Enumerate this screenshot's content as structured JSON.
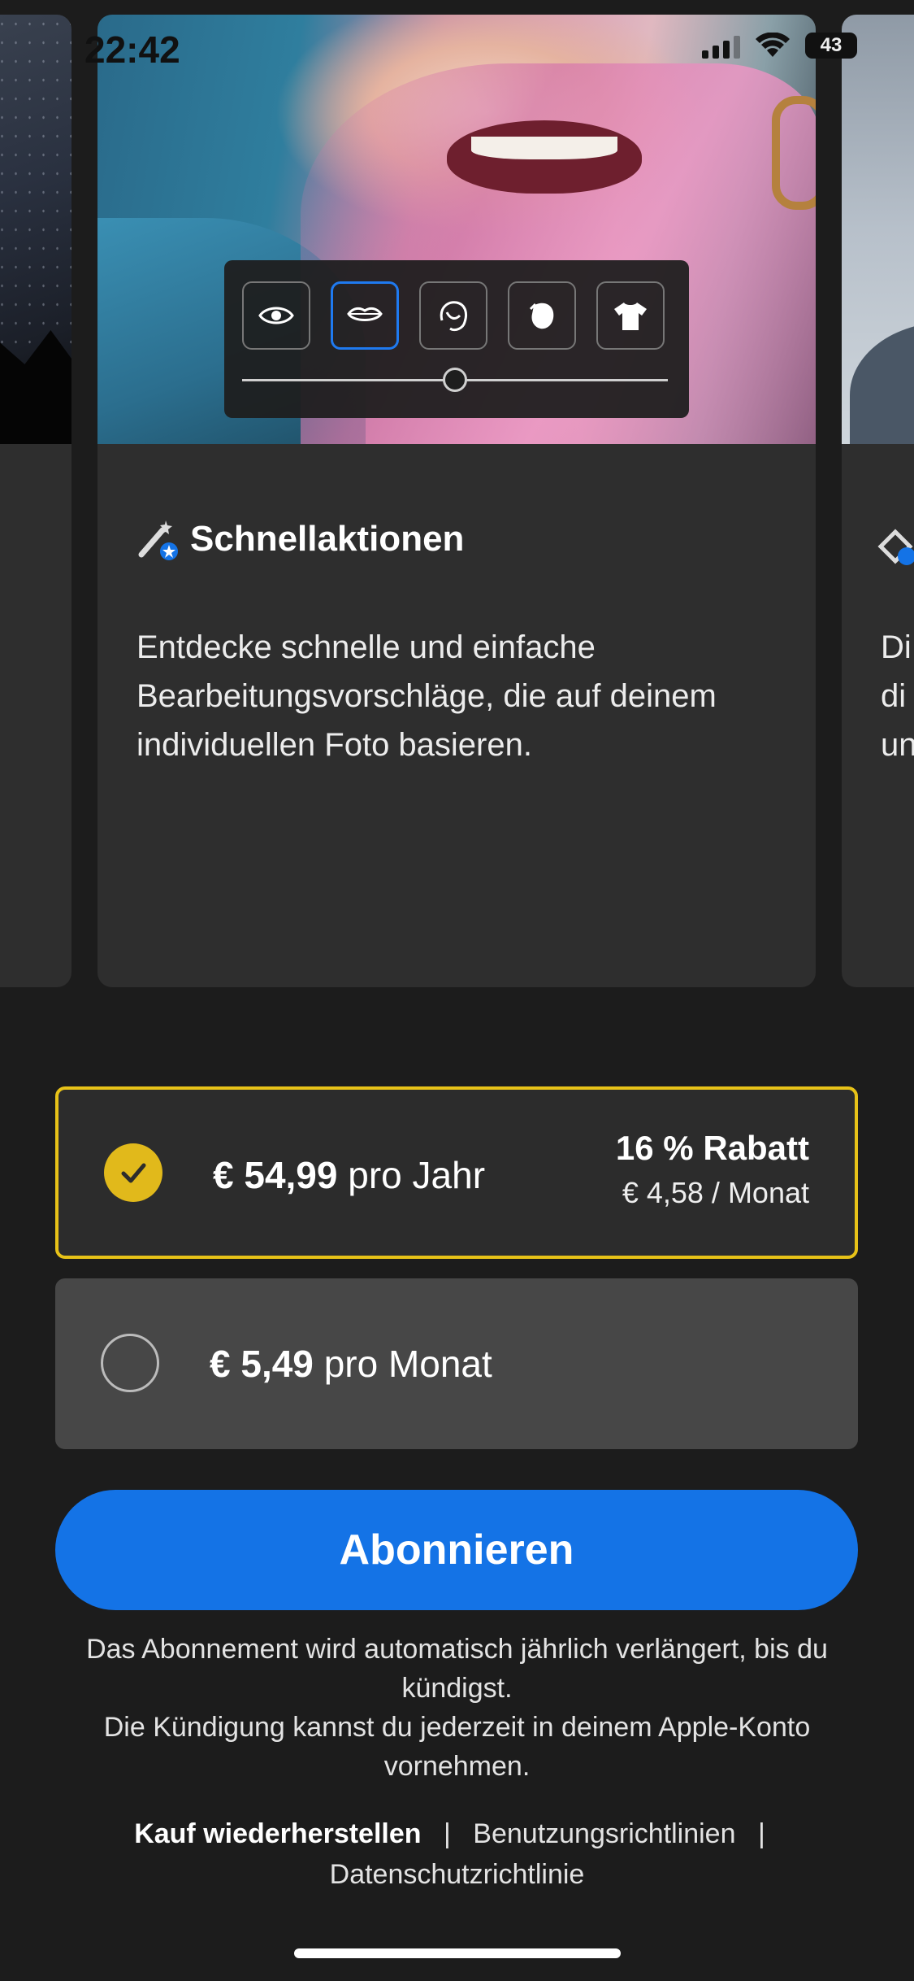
{
  "status_bar": {
    "time": "22:42",
    "battery": "43"
  },
  "features": {
    "main": {
      "title": "Schnellaktionen",
      "description": "Entdecke schnelle und einfache Bearbeitungsvorschläge, die auf deinem individuellen Foto basieren.",
      "tools": [
        "eye-icon",
        "lips-icon",
        "hair-icon",
        "face-icon",
        "shirt-icon"
      ],
      "active_tool": "lips-icon",
      "slider_value": 0.5
    },
    "next": {
      "description_peek": "Di\ndi\nun"
    }
  },
  "plans": {
    "yearly": {
      "price": "€ 54,99",
      "period": "pro Jahr",
      "discount": "16 % Rabatt",
      "per_month": "€ 4,58 / Monat",
      "selected": true
    },
    "monthly": {
      "price": "€ 5,49",
      "period": "pro Monat",
      "selected": false
    }
  },
  "subscribe_label": "Abonnieren",
  "notice": {
    "line1": "Das Abonnement wird automatisch jährlich verlängert, bis du kündigst.",
    "line2": "Die Kündigung kannst du jederzeit in deinem Apple-Konto vornehmen."
  },
  "links": {
    "restore": "Kauf wiederherstellen",
    "terms": "Benutzungsrichtlinien",
    "privacy": "Datenschutzrichtlinie",
    "separator": "|"
  },
  "colors": {
    "accent": "#1473e6",
    "selected_border": "#e7c218",
    "check": "#e1b91b"
  }
}
